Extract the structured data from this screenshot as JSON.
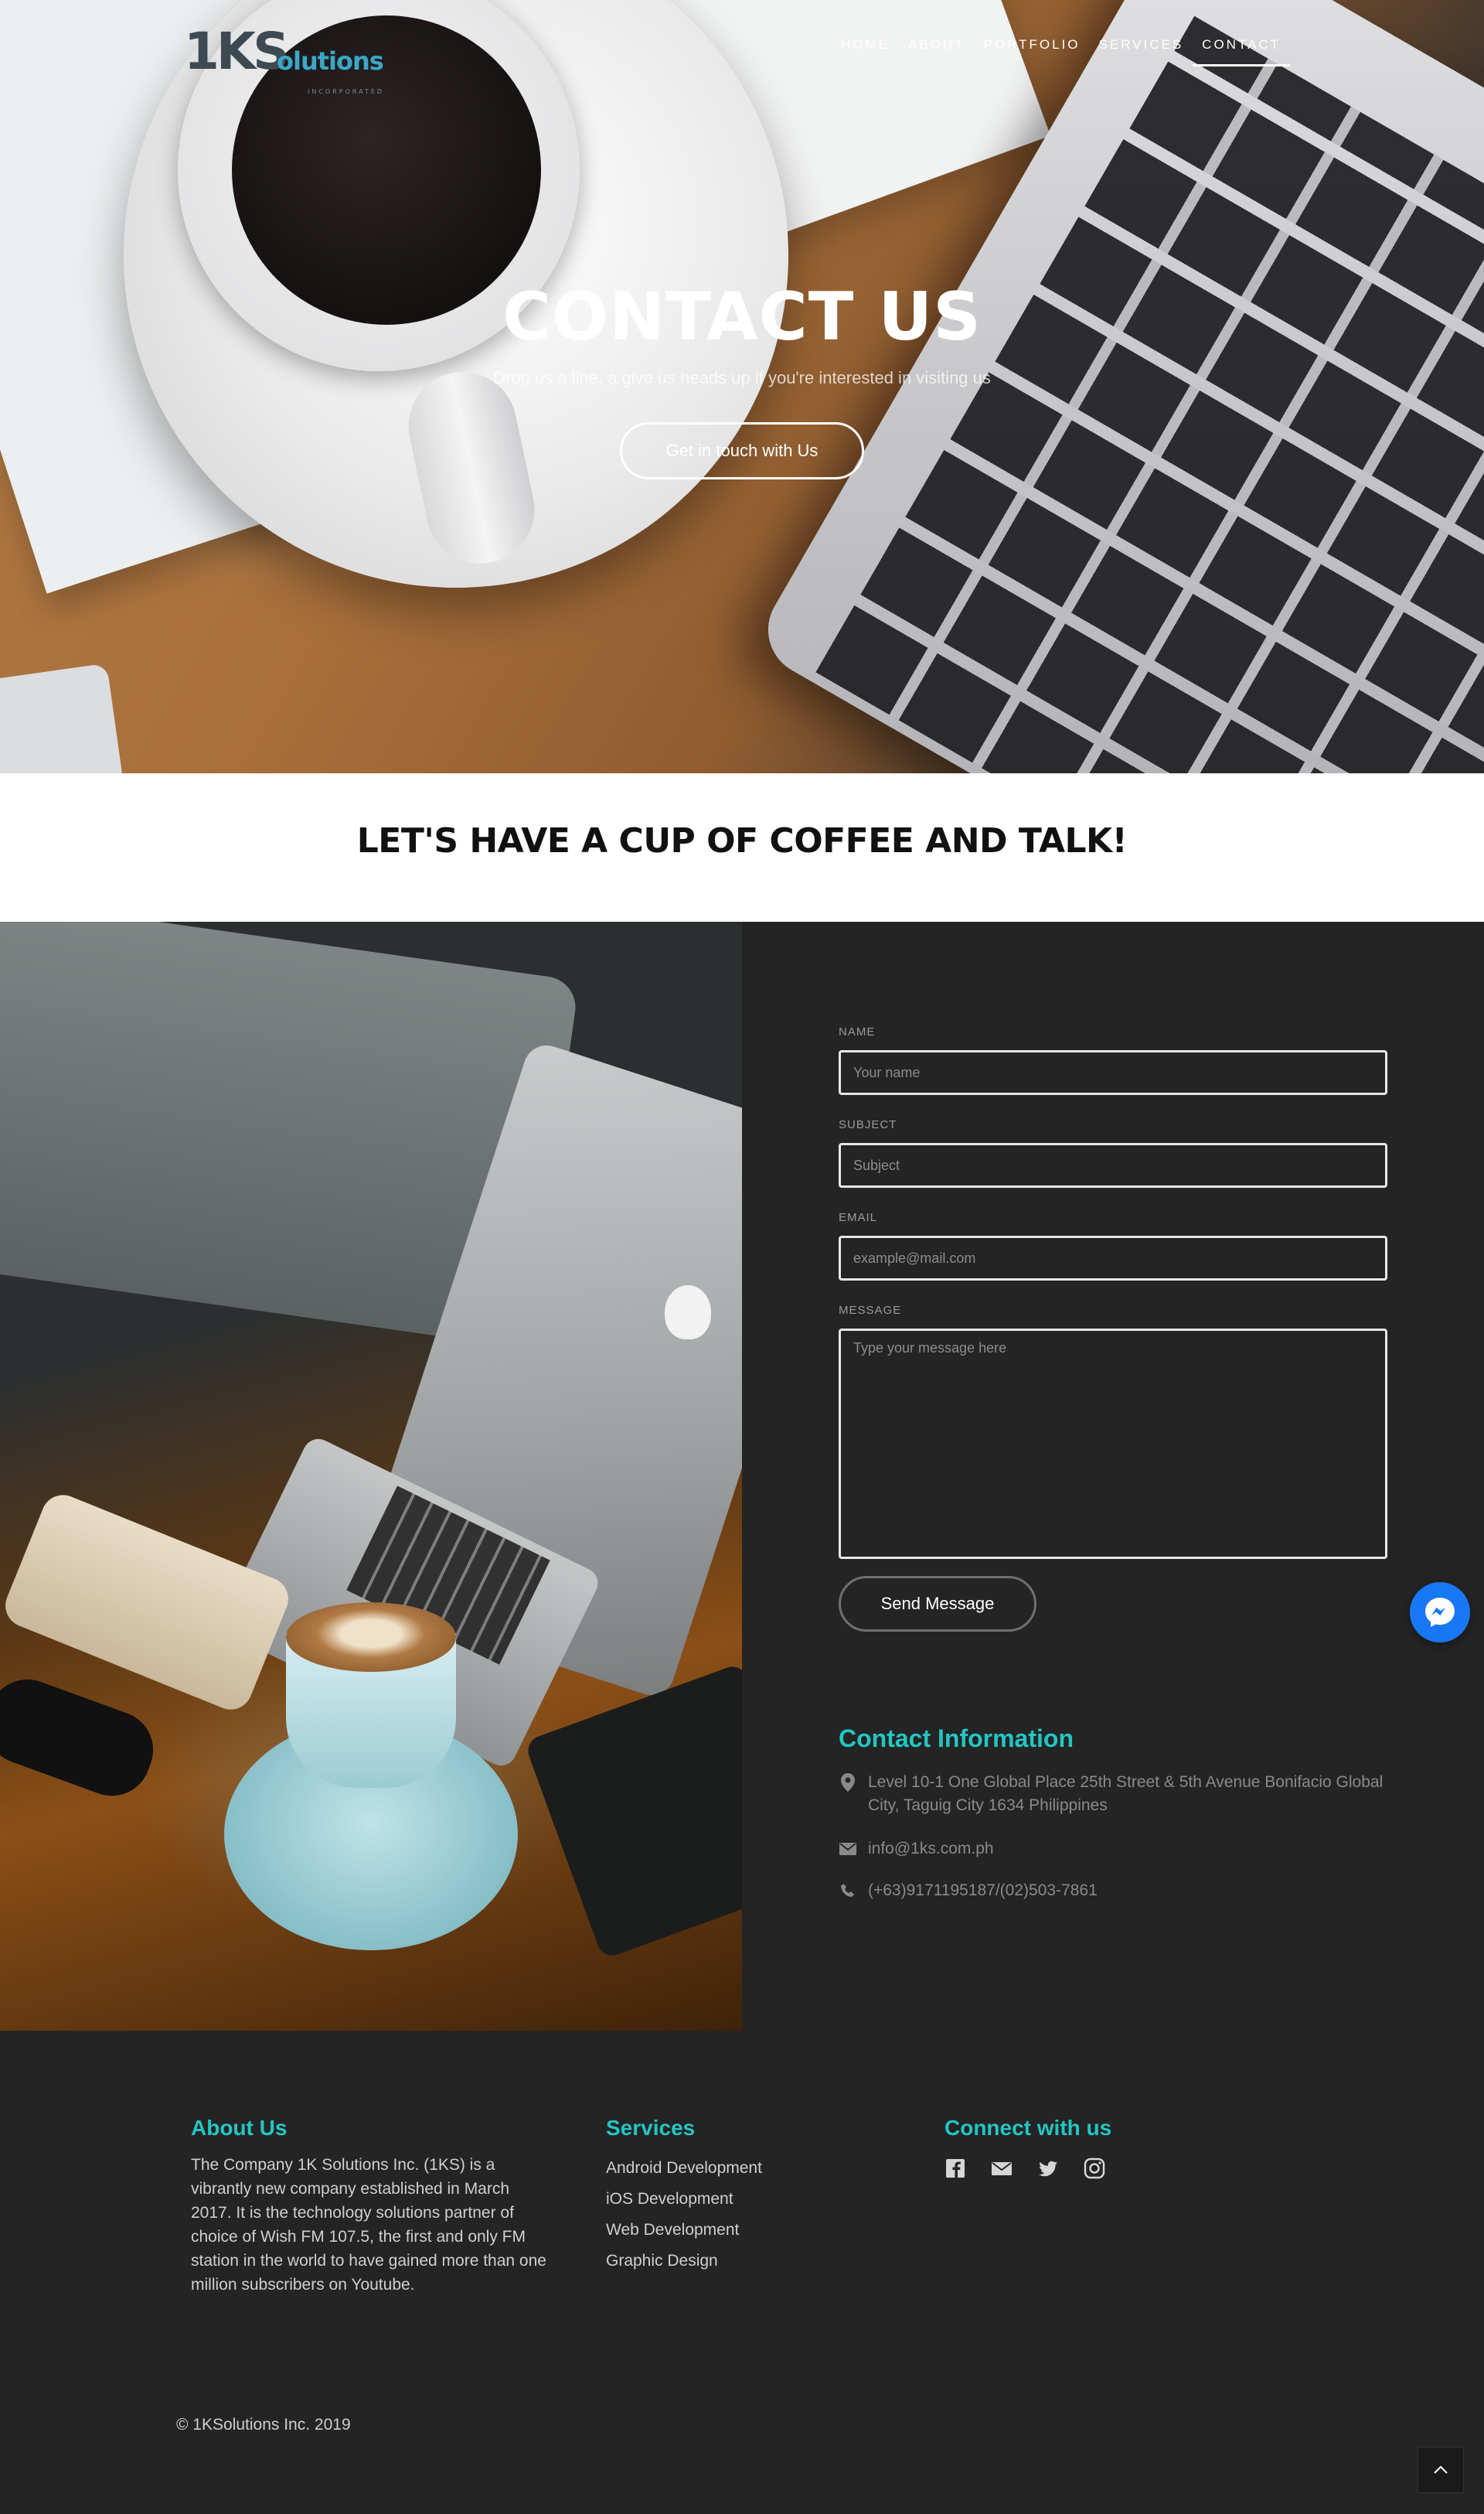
{
  "header": {
    "logo": {
      "mark": "1KS",
      "word": "olutions",
      "sub": "INCORPORATED"
    },
    "nav": [
      {
        "label": "HOME"
      },
      {
        "label": "ABOUT"
      },
      {
        "label": "PORTFOLIO"
      },
      {
        "label": "SERVICES"
      },
      {
        "label": "CONTACT",
        "active": true
      }
    ]
  },
  "hero": {
    "title": "CONTACT US",
    "subtitle": "Drop us a line, a give us heads up if you're interested in visiting us",
    "button_label": "Get in touch with Us"
  },
  "tagline": {
    "heading": "LET'S HAVE A CUP OF COFFEE AND TALK!"
  },
  "form": {
    "name": {
      "label": "NAME",
      "placeholder": "Your name",
      "value": ""
    },
    "subject": {
      "label": "SUBJECT",
      "placeholder": "Subject",
      "value": ""
    },
    "email": {
      "label": "EMAIL",
      "placeholder": "example@mail.com",
      "value": ""
    },
    "message": {
      "label": "MESSAGE",
      "placeholder": "Type your message here",
      "value": ""
    },
    "send_label": "Send Message"
  },
  "contact_info": {
    "title": "Contact Information",
    "address": "Level 10-1 One Global Place 25th Street & 5th Avenue Bonifacio Global City, Taguig City 1634 Philippines",
    "email": "info@1ks.com.ph",
    "phone": "(+63)9171195187/(02)503-7861",
    "icons": [
      "map-pin-icon",
      "mail-icon",
      "phone-icon"
    ]
  },
  "footer": {
    "about": {
      "title": "About Us",
      "text": "The Company 1K Solutions Inc. (1KS) is a vibrantly new company established in March 2017. It is the technology solutions partner of choice of Wish FM 107.5, the first and only FM station in the world to have gained more than one million subscribers on Youtube."
    },
    "services": {
      "title": "Services",
      "items": [
        "Android Development",
        "iOS Development",
        "Web Development",
        "Graphic Design"
      ]
    },
    "connect": {
      "title": "Connect with us",
      "icons": [
        "facebook-icon",
        "mail-icon",
        "twitter-icon",
        "instagram-icon"
      ]
    },
    "copyright": "© 1KSolutions Inc. 2019"
  },
  "colors": {
    "accent": "#23c6c4",
    "background": "#242424",
    "messenger": "#1877f2"
  }
}
